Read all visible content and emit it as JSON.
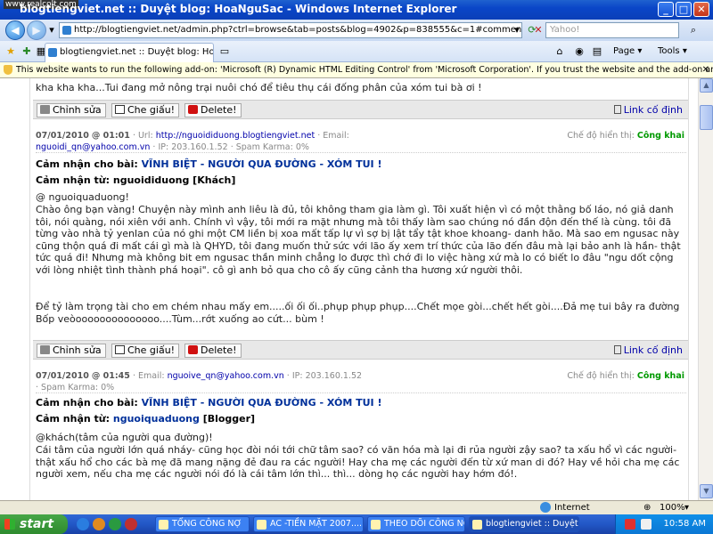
{
  "window": {
    "watermark": "www.realcolt.com",
    "title": "blogtiengviet.net :: Duyệt blog: HoaNguSac - Windows Internet Explorer"
  },
  "address": {
    "url": "http://blogtiengviet.net/admin.php?ctrl=browse&tab=posts&blog=4902&p=838555&c=1#comments",
    "search_placeholder": "Yahoo!"
  },
  "tab": {
    "label": "blogtiengviet.net :: Duyệt blog: HoaNguSac",
    "page_label": "Page",
    "tools_label": "Tools"
  },
  "infobar": {
    "text": "This website wants to run the following add-on: 'Microsoft (R) Dynamic HTML Editing Control' from 'Microsoft Corporation'. If you trust the website and the add-on and want to allow it to run, click here..."
  },
  "top_comment": "kha kha kha...Tui đang mở nông trại nuôi chó để tiêu thụ cái đống phân của xóm tui bà ơi !",
  "actions": {
    "edit": "Chỉnh sửa",
    "hide": "Che giấu!",
    "delete": "Delete!",
    "permalink": "Link cố định"
  },
  "comment1": {
    "date": "07/01/2010",
    "time": "@ 01:01",
    "url_label": "· Url:",
    "url": "http://nguoididuong.blogtiengviet.net",
    "email_label": "· Email:",
    "email": "nguoidi_qn@yahoo.com.vn",
    "ip": "· IP: 203.160.1.52",
    "spam": "· Spam Karma: 0%",
    "mode_label": "Chế độ hiển thị:",
    "mode": "Công khai",
    "post_label": "Cảm nhận cho bài:",
    "post_title": "VĨNH BIỆT - NGƯỜI QUA ĐƯỜNG - XÓM TUI !",
    "author_label": "Cảm nhận từ:",
    "author": "nguoididuong [Khách]",
    "line1": "@ nguoiquaduong!",
    "para": "Chào ông bạn vàng! Chuyện này mình anh liêu là đủ, tôi không tham gia làm gì. Tôi xuất hiện vì có một thằng bố láo, nó giả danh tôi, nói quàng, nói xiên với anh. Chính vì vậy, tôi mới ra mặt nhưng mà tôi thấy làm sao chúng nó đần độn đến thế là cùng. tôi đã từng vào nhà tỷ yenlan của nó ghi một CM liền bị xoa mất tấp lự vì sợ bị lật tẩy tật khoe khoang- danh hão. Mà sao em ngusac này cũng thộn quá đi mất cái gì mà là QHYD, tôi đang muốn thử sức với lão ấy xem trí thức của lão đến đâu mà lại bảo anh là hần- thật tức quá đi! Nhưng mà không bit em ngusac thần minh chẳng lo được thì chớ đi lo việc hàng xứ mà lo có biết lo đâu \"ngu dốt cộng với lòng nhiệt tình thành phá hoại\". cô gì anh bỏ qua cho cô ấy cũng cảnh tha hương xứ người thôi.",
    "purple": "Để tỷ làm trọng tài cho em chém nhau mấy em.....ối ối ối..phụp phụp phụp....Chết mọe gòi...chết hết gòi....Đả mẹ tui bây ra đường Bốp veòoooooooooooooo....Tùm...rớt xuống ao cứt... bùm !"
  },
  "comment2": {
    "date": "07/01/2010",
    "time": "@ 01:45",
    "email_label": "· Email:",
    "email": "nguoive_qn@yahoo.com.vn",
    "ip": "· IP: 203.160.1.52",
    "spam": "· Spam Karma: 0%",
    "mode_label": "Chế độ hiển thị:",
    "mode": "Công khai",
    "post_label": "Cảm nhận cho bài:",
    "post_title": "VĨNH BIỆT - NGƯỜI QUA ĐƯỜNG - XÓM TUI !",
    "author_label": "Cảm nhận từ:",
    "author": "nguoiquaduong",
    "author_role": "[Blogger]",
    "line1": "@khách(tâm của người qua đường)!",
    "para": "Cái tâm của người lớn quá nháy- cũng học đòi nói tới chữ tâm sao? có văn hóa mà lại đi rủa người zậy sao? ta xấu hổ vì các người- thật xấu hổ cho các bà mẹ đã mang nặng đẻ đau ra các người! Hay cha mẹ các người đến từ xứ man di đó? Hay về hỏi cha mẹ các người xem, nếu cha mẹ các người nói đó là cái tâm lớn thì... thì... dòng họ các người hay hớm đó!."
  },
  "status": {
    "zone": "Internet",
    "zoom": "100%"
  },
  "taskbar": {
    "start": "start",
    "tasks": [
      "TỔNG CÔNG NỢ",
      "AC -TIỀN MẶT 2007....",
      "THEO DÕI CÔNG NỢ",
      "blogtiengviet :: Duyệt..."
    ],
    "clock": "10:58 AM"
  }
}
